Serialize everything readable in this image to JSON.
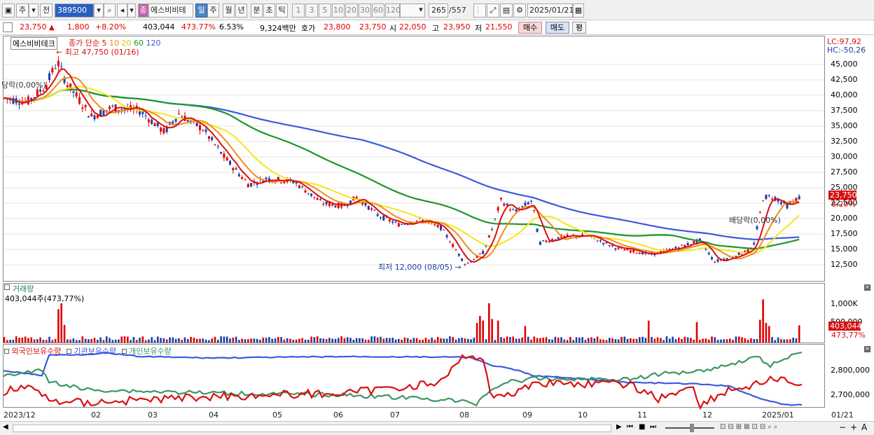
{
  "toolbar": {
    "market_label": "주",
    "prev_label": "전",
    "stock_code": "389500",
    "stock_name": "에스비비테",
    "stock_type_badge": "종",
    "period_buttons": [
      "일",
      "주",
      "월",
      "년",
      "분",
      "초",
      "틱"
    ],
    "period_selected": "일",
    "interval_buttons": [
      "1",
      "3",
      "5",
      "10",
      "20",
      "30",
      "60",
      "120"
    ],
    "bar_count": "265",
    "bar_total": "/557",
    "date": "2025/01/21"
  },
  "quote": {
    "price": "23,750",
    "change": "1,800",
    "change_pct": "+8.20%",
    "volume": "403,044",
    "volume_ratio": "473.77%",
    "turnover": "6.53%",
    "amount": "9,324백만",
    "ask_label": "호가",
    "ask": "23,800",
    "bid": "23,750",
    "open_label": "시",
    "open": "22,050",
    "high_label": "고",
    "high": "23,950",
    "low_label": "저",
    "low": "21,550",
    "buy_button": "매수",
    "sell_button": "매도",
    "eval_button": "평"
  },
  "price_panel": {
    "name_box": "에스비비테크",
    "legend_text": "종가 단순",
    "ma_labels": [
      "5",
      "10",
      "20",
      "60",
      "120"
    ],
    "high_annotation": "최고 47,750 (01/16)",
    "low_annotation": "최저 12,000 (08/05)",
    "dividend_left": "당락(0,00%)",
    "dividend_right": "배당락(0,00%)",
    "lc_label": "LC:97,92",
    "hc_label": "HC:-50,26",
    "price_tag": "23,750",
    "pct_tag": "8.20%",
    "y_ticks": [
      "45,000",
      "42,500",
      "40,000",
      "37,500",
      "35,000",
      "32,500",
      "30,000",
      "27,500",
      "25,000",
      "22,500",
      "20,000",
      "17,500",
      "15,000",
      "12,500"
    ]
  },
  "volume_panel": {
    "title": "거래량",
    "value_text": "403,044주(473,77%)",
    "y_ticks": [
      "1,000K",
      "500,000"
    ],
    "value_tag": "403,044",
    "pct_tag": "473,77%"
  },
  "holdings_panel": {
    "legend": [
      "외국인보유수량",
      "기관보유수량",
      "개인보유수량"
    ],
    "y_ticks": [
      "2,800,000",
      "2,700,000"
    ]
  },
  "x_ticks": [
    "2023/12",
    "02",
    "03",
    "04",
    "05",
    "06",
    "07",
    "08",
    "09",
    "10",
    "11",
    "12",
    "2025/01",
    "01/21"
  ],
  "colors": {
    "up": "#e00000",
    "down": "#1a3ea8",
    "ma5": "#d81010",
    "ma10": "#f08c1c",
    "ma20": "#f5e61e",
    "ma60": "#1e9628",
    "ma120": "#3c5adc",
    "foreign": "#d81010",
    "institution": "#3c5adc",
    "individual": "#3c9664"
  }
}
